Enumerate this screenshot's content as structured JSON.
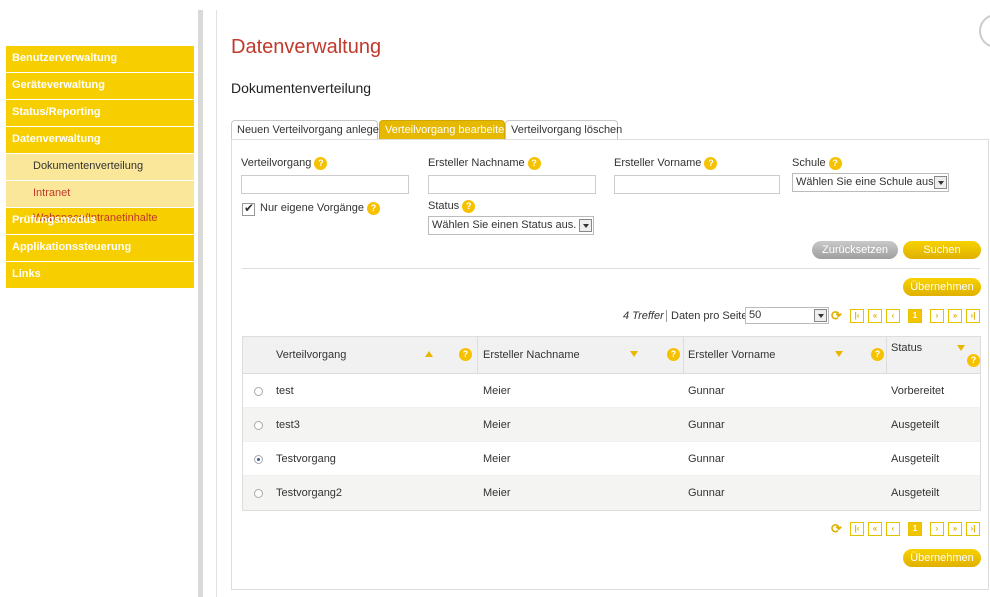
{
  "sidebar": {
    "items": [
      {
        "label": "Benutzerverwaltung"
      },
      {
        "label": "Geräteverwaltung"
      },
      {
        "label": "Status/Reporting"
      },
      {
        "label": "Datenverwaltung"
      },
      {
        "label": "Dokumentenverteilung"
      },
      {
        "label": "Intranet Webspace/Intranetinhalte"
      },
      {
        "label": "Prüfungsmodus"
      },
      {
        "label": "Applikationssteuerung"
      },
      {
        "label": "Links"
      }
    ]
  },
  "header": {
    "title": "Datenverwaltung",
    "subtitle": "Dokumentenverteilung"
  },
  "tabs": [
    {
      "label": "Neuen Verteilvorgang anlegen"
    },
    {
      "label": "Verteilvorgang bearbeiten"
    },
    {
      "label": "Verteilvorgang löschen"
    }
  ],
  "filters": {
    "verteilvorgang_label": "Verteilvorgang",
    "verteilvorgang_value": "",
    "nachname_label": "Ersteller Nachname",
    "nachname_value": "",
    "vorname_label": "Ersteller Vorname",
    "vorname_value": "",
    "schule_label": "Schule",
    "schule_value": "Wählen Sie eine Schule aus",
    "eigene_label": "Nur eigene Vorgänge",
    "status_label": "Status",
    "status_value": "Wählen Sie einen Status aus.",
    "reset_label": "Zurücksetzen",
    "search_label": "Suchen",
    "help_glyph": "?"
  },
  "results": {
    "apply_label": "Übernehmen",
    "hits": "4 Treffer",
    "per_page_label": "Daten pro Seite:",
    "per_page_value": "50",
    "current_page": "1",
    "columns": [
      "Verteilvorgang",
      "Ersteller Nachname",
      "Ersteller Vorname",
      "Status"
    ],
    "rows": [
      {
        "name": "test",
        "nachname": "Meier",
        "vorname": "Gunnar",
        "status": "Vorbereitet"
      },
      {
        "name": "test3",
        "nachname": "Meier",
        "vorname": "Gunnar",
        "status": "Ausgeteilt"
      },
      {
        "name": "Testvorgang",
        "nachname": "Meier",
        "vorname": "Gunnar",
        "status": "Ausgeteilt"
      },
      {
        "name": "Testvorgang2",
        "nachname": "Meier",
        "vorname": "Gunnar",
        "status": "Ausgeteilt"
      }
    ]
  },
  "colors": {
    "accent": "#f7ce00",
    "title": "#c0392b"
  }
}
